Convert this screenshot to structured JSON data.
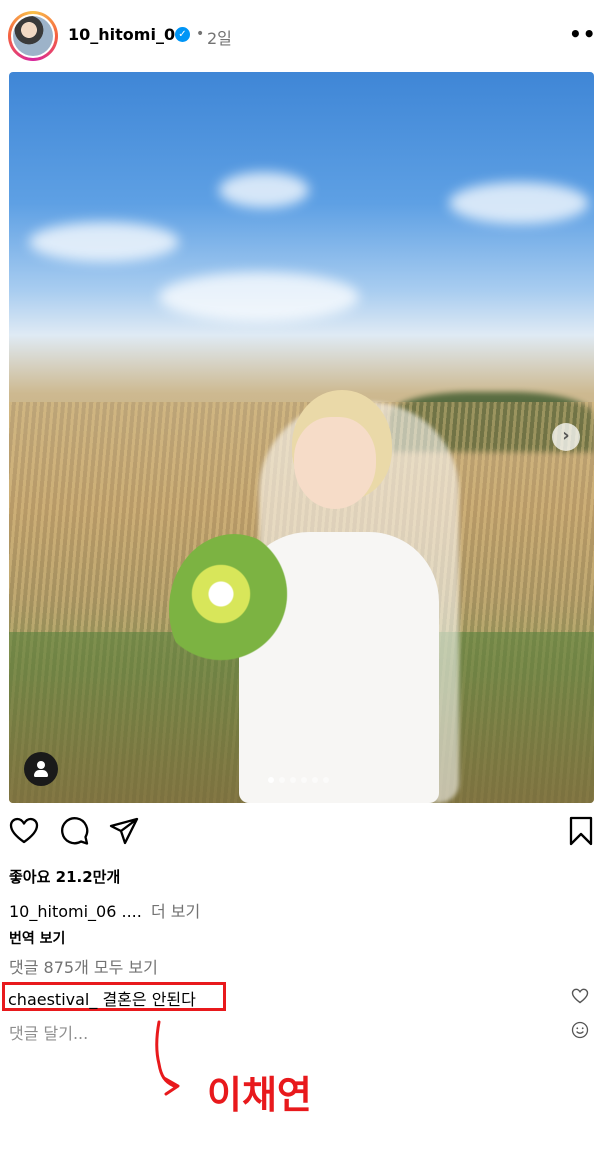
{
  "post": {
    "username": "10_hitomi_06",
    "verified_mark": "✓",
    "dot_separator": "•",
    "time_ago": "2일",
    "more_icon": "…",
    "more_label": "•••"
  },
  "media": {
    "next_label": "›",
    "carousel_total": 6,
    "carousel_active_index": 0
  },
  "actions": {
    "icons": [
      "heart-icon",
      "comment-icon",
      "share-icon",
      "bookmark-icon"
    ]
  },
  "likes": {
    "label": "좋아요",
    "count": "21.2만개"
  },
  "caption": {
    "username": "10_hitomi_06",
    "ellipsis": "....",
    "more": "더 보기"
  },
  "translate_label": "번역 보기",
  "comments": {
    "view_all": "댓글 875개 모두 보기",
    "highlighted": {
      "username": "chaestival_",
      "text": "결혼은 안된다"
    },
    "add_placeholder": "댓글 달기..."
  },
  "annotation": {
    "text": "이채연",
    "color": "#e8191c"
  },
  "colors": {
    "accent_blue": "#0095f6",
    "muted_text": "#737373",
    "highlight_red": "#e8191c"
  }
}
